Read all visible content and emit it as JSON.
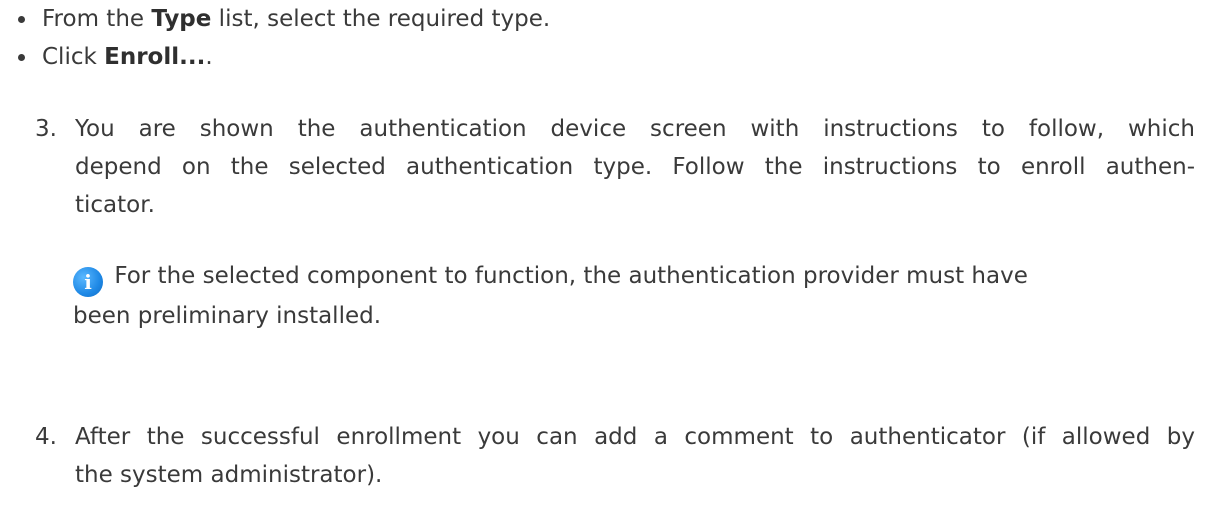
{
  "bullets": [
    {
      "prefix": "From the ",
      "bold": "Type",
      "suffix": " list, select the required type."
    },
    {
      "prefix": "Click ",
      "bold": "Enroll...",
      "suffix": "."
    }
  ],
  "step3": {
    "number": "3.",
    "lines": [
      "You are shown the authentication device screen with instructions to follow, which",
      "depend on the selected authentication type. Follow the instructions to enroll authen-",
      "ticator."
    ]
  },
  "note": {
    "icon": "info-icon",
    "lines": [
      "For the selected component to function, the authentication provider must have",
      "been preliminary installed."
    ]
  },
  "step4": {
    "number": "4.",
    "lines": [
      "After the successful enrollment you can add a comment to authenticator (if allowed by",
      "the system administrator)."
    ]
  }
}
